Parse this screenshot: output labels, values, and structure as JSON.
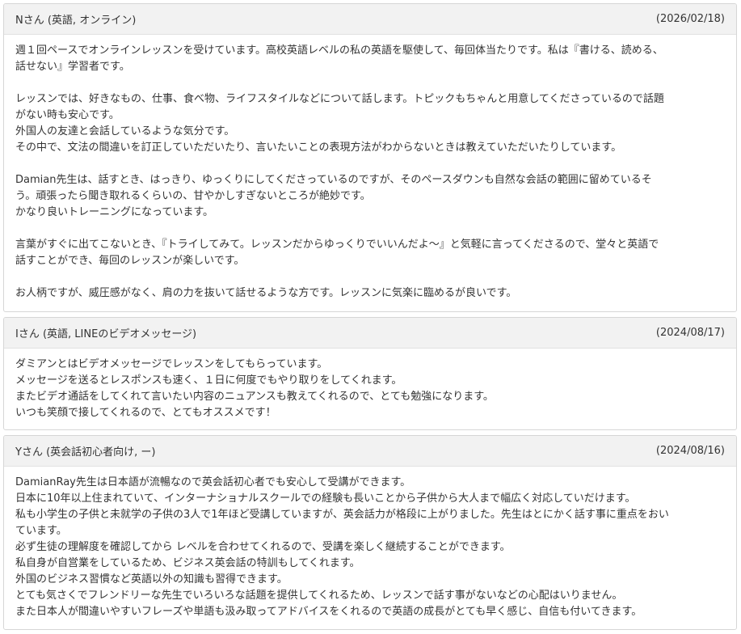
{
  "reviews": [
    {
      "name": "Nさん (英語, オンライン)",
      "date": "(2026/02/18)",
      "lines": [
        "週１回ペースでオンラインレッスンを受けています。高校英語レベルの私の英語を駆使して、毎回体当たりです。私は『書ける、読める、",
        "話せない』学習者です。",
        "",
        "レッスンでは、好きなもの、仕事、食べ物、ライフスタイルなどについて話します。トピックもちゃんと用意してくださっているので話題",
        "がない時も安心です。",
        "外国人の友達と会話しているような気分です。",
        "その中で、文法の間違いを訂正していただいたり、言いたいことの表現方法がわからないときは教えていただいたりしています。",
        "",
        "Damian先生は、話すとき、はっきり、ゆっくりにしてくださっているのですが、そのペースダウンも自然な会話の範囲に留めているそ",
        "う。頑張ったら聞き取れるくらいの、甘やかしすぎないところが絶妙です。",
        "かなり良いトレーニングになっています。",
        "",
        "言葉がすぐに出てこないとき、『トライしてみて。レッスンだからゆっくりでいいんだよ～』と気軽に言ってくださるので、堂々と英語で",
        "話すことができ、毎回のレッスンが楽しいです。",
        "",
        "お人柄ですが、威圧感がなく、肩の力を抜いて話せるような方です。レッスンに気楽に臨めるが良いです。"
      ]
    },
    {
      "name": "Iさん (英語, LINEのビデオメッセージ)",
      "date": "(2024/08/17)",
      "lines": [
        "ダミアンとはビデオメッセージでレッスンをしてもらっています。",
        "メッセージを送るとレスポンスも速く、１日に何度でもやり取りをしてくれます。",
        "またビデオ通話をしてくれて言いたい内容のニュアンスも教えてくれるので、とても勉強になります。",
        "いつも笑顔で接してくれるので、とてもオススメです！"
      ]
    },
    {
      "name": "Yさん (英会話初心者向け, ー)",
      "date": "(2024/08/16)",
      "lines": [
        "DamianRay先生は日本語が流暢なので英会話初心者でも安心して受講ができます。",
        "日本に10年以上住まれていて、インターナショナルスクールでの経験も長いことから子供から大人まで幅広く対応していだけます。",
        "私も小学生の子供と未就学の子供の3人で1年ほど受講していますが、英会話力が格段に上がりました。先生はとにかく話す事に重点をおい",
        "ています。",
        "必ず生徒の理解度を確認してから レベルを合わせてくれるので、受講を楽しく継続することができます。",
        "私自身が自営業をしているため、ビジネス英会話の特訓もしてくれます。",
        "外国のビジネス習慣など英語以外の知識も習得できます。",
        "とても気さくでフレンドリーな先生でいろいろな話題を提供してくれるため、レッスンで話す事がないなどの心配はいりません。",
        "また日本人が間違いやすいフレーズや単語も汲み取ってアドバイスをくれるので英語の成長がとても早く感じ、自信も付いてきます。"
      ]
    }
  ]
}
